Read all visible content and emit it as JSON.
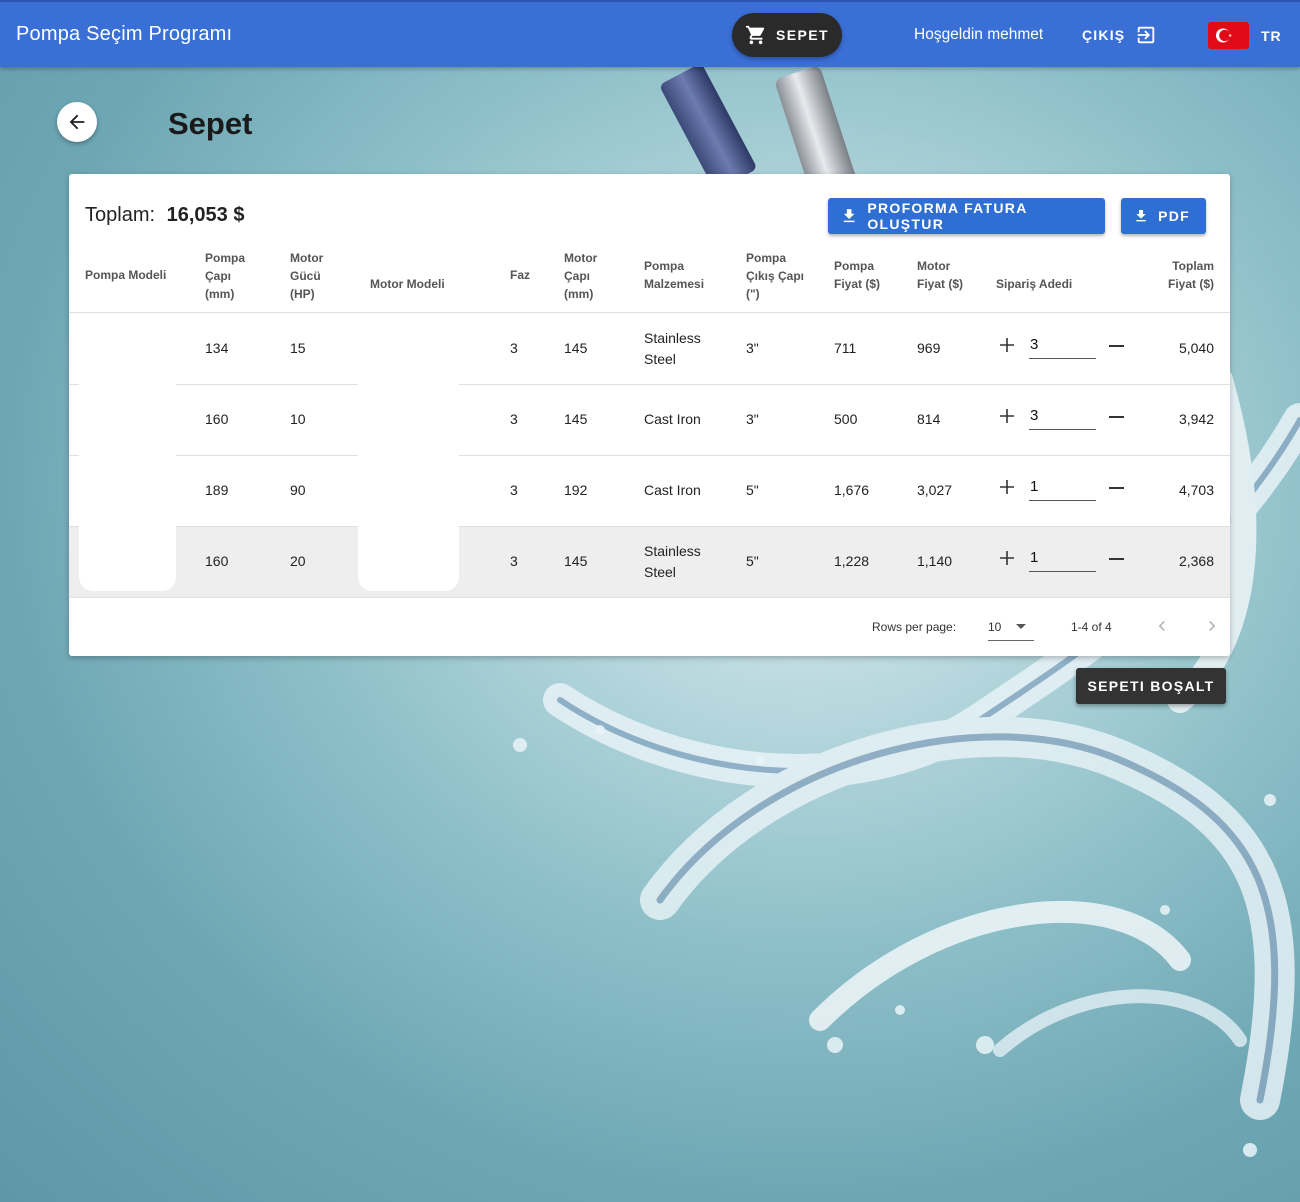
{
  "app": {
    "title": "Pompa Seçim Programı",
    "cart_label": "SEPET",
    "welcome": "Hoşgeldin mehmet",
    "logout_label": "ÇIKIŞ",
    "language": "TR",
    "bar_color": "#3a6fd6"
  },
  "page": {
    "title": "Sepet"
  },
  "summary": {
    "total_label": "Toplam:",
    "total_value": "16,053 $",
    "proforma_label": "PROFORMA FATURA OLUŞTUR",
    "pdf_label": "PDF"
  },
  "table": {
    "headers": {
      "pump_model": "Pompa Modeli",
      "pump_diameter": "Pompa Çapı (mm)",
      "motor_power": "Motor Gücü (HP)",
      "motor_model": "Motor Modeli",
      "phase": "Faz",
      "motor_diameter": "Motor Çapı (mm)",
      "pump_material": "Pompa Malzemesi",
      "pump_outlet": "Pompa Çıkış Çapı (\")",
      "pump_price": "Pompa Fiyat ($)",
      "motor_price": "Motor Fiyat ($)",
      "order_qty": "Sipariş Adedi",
      "total_price": "Toplam Fiyat ($)"
    },
    "rows": [
      {
        "pump_model": "",
        "pump_diameter": "134",
        "motor_power": "15",
        "motor_model": "",
        "phase": "3",
        "motor_diameter": "145",
        "pump_material": "Stainless Steel",
        "pump_outlet": "3\"",
        "pump_price": "711",
        "motor_price": "969",
        "order_qty": "3",
        "total_price": "5,040"
      },
      {
        "pump_model": "",
        "pump_diameter": "160",
        "motor_power": "10",
        "motor_model": "",
        "phase": "3",
        "motor_diameter": "145",
        "pump_material": "Cast Iron",
        "pump_outlet": "3\"",
        "pump_price": "500",
        "motor_price": "814",
        "order_qty": "3",
        "total_price": "3,942"
      },
      {
        "pump_model": "",
        "pump_diameter": "189",
        "motor_power": "90",
        "motor_model": "",
        "phase": "3",
        "motor_diameter": "192",
        "pump_material": "Cast Iron",
        "pump_outlet": "5\"",
        "pump_price": "1,676",
        "motor_price": "3,027",
        "order_qty": "1",
        "total_price": "4,703"
      },
      {
        "pump_model": "",
        "pump_diameter": "160",
        "motor_power": "20",
        "motor_model": "",
        "phase": "3",
        "motor_diameter": "145",
        "pump_material": "Stainless Steel",
        "pump_outlet": "5\"",
        "pump_price": "1,228",
        "motor_price": "1,140",
        "order_qty": "1",
        "total_price": "2,368"
      }
    ]
  },
  "pagination": {
    "rows_per_page_label": "Rows per page:",
    "rows_per_page": "10",
    "range": "1-4 of 4"
  },
  "empty_cart_label": "SEPETI BOŞALT",
  "icons": {
    "cart": "cart-icon",
    "logout": "logout-icon",
    "flag": "turkey-flag-icon",
    "back": "arrow-left-icon",
    "download": "download-icon",
    "plus": "plus-icon",
    "minus": "minus-icon",
    "dropdown": "chevron-down-icon",
    "prev": "chevron-left-icon",
    "next": "chevron-right-icon"
  }
}
